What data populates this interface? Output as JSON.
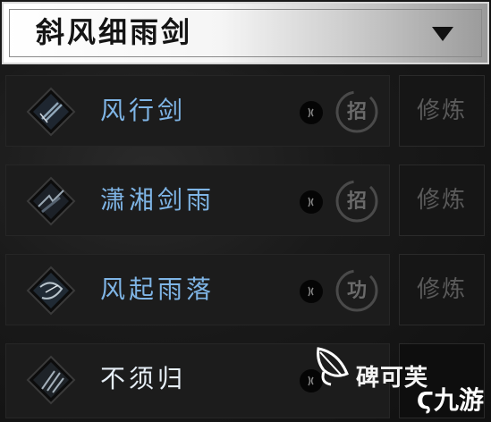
{
  "header": {
    "title": "斜风细雨剑"
  },
  "skills": [
    {
      "name": "风行剑",
      "seal": "招",
      "action": "修炼"
    },
    {
      "name": "潇湘剑雨",
      "seal": "招",
      "action": "修炼"
    },
    {
      "name": "风起雨落",
      "seal": "功",
      "action": "修炼"
    },
    {
      "name": "不须归",
      "seal": "",
      "action": ""
    }
  ],
  "watermark": {
    "text": "碑可芙",
    "logo": "九游"
  },
  "colors": {
    "skill_name": "#7fb5e6",
    "muted_button": "#5a5a5a"
  }
}
